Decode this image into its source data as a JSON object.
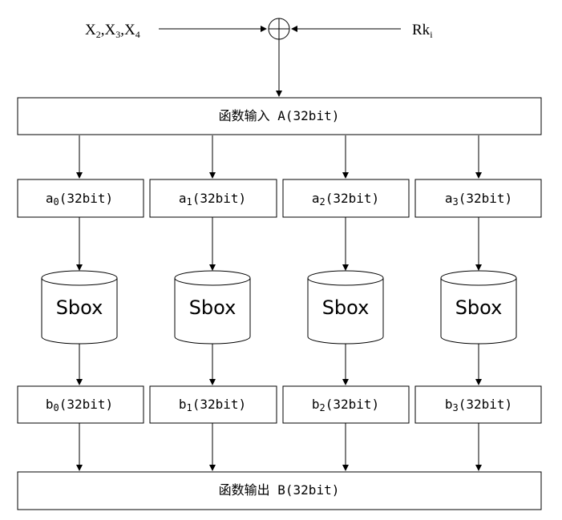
{
  "inputs": {
    "left": {
      "X1": "X",
      "s1": "2",
      "c1": ",",
      "X2": "X",
      "s2": "3",
      "c2": ",",
      "X3": "X",
      "s3": "4"
    },
    "right": {
      "label": "Rk",
      "sub": "i"
    }
  },
  "input_box": {
    "label": "函数输入  A(32bit)"
  },
  "output_box": {
    "label": "函数输出  B(32bit)"
  },
  "a_boxes": [
    {
      "base": "a",
      "sub": "0",
      "suffix": "(32bit)"
    },
    {
      "base": "a",
      "sub": "1",
      "suffix": "(32bit)"
    },
    {
      "base": "a",
      "sub": "2",
      "suffix": "(32bit)"
    },
    {
      "base": "a",
      "sub": "3",
      "suffix": "(32bit)"
    }
  ],
  "sboxes": [
    {
      "label": "Sbox"
    },
    {
      "label": "Sbox"
    },
    {
      "label": "Sbox"
    },
    {
      "label": "Sbox"
    }
  ],
  "b_boxes": [
    {
      "base": "b",
      "sub": "0",
      "suffix": "(32bit)"
    },
    {
      "base": "b",
      "sub": "1",
      "suffix": "(32bit)"
    },
    {
      "base": "b",
      "sub": "2",
      "suffix": "(32bit)"
    },
    {
      "base": "b",
      "sub": "3",
      "suffix": "(32bit)"
    }
  ]
}
